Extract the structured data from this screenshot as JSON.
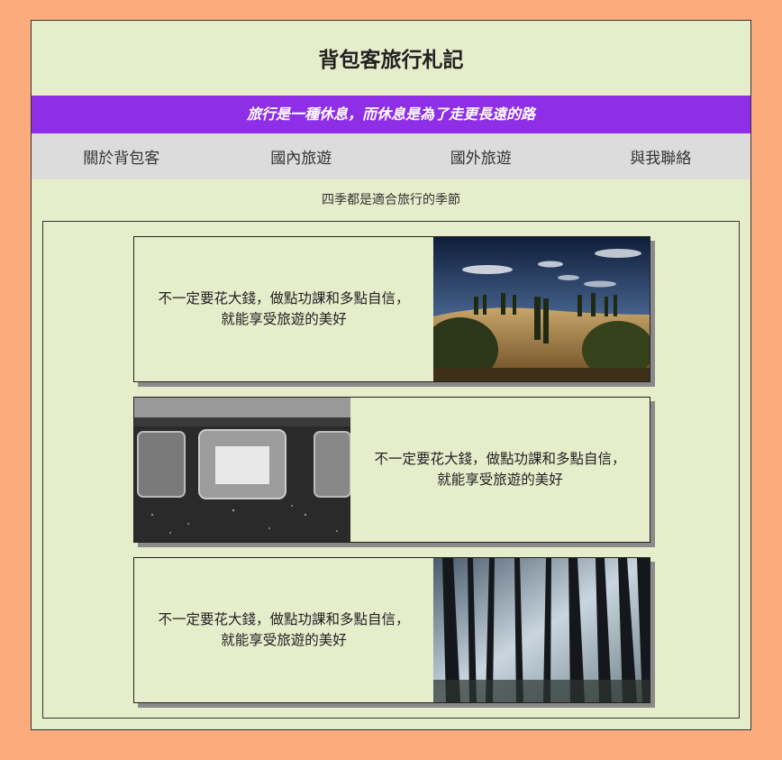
{
  "header": {
    "title": "背包客旅行札記",
    "slogan": "旅行是一種休息，而休息是為了走更長遠的路"
  },
  "nav": {
    "items": [
      "關於背包客",
      "國內旅遊",
      "國外旅遊",
      "與我聯絡"
    ]
  },
  "main": {
    "subtitle": "四季都是適合旅行的季節",
    "cards": [
      {
        "text_line1": "不一定要花大錢，做點功課和多點自信，",
        "text_line2": "就能享受旅遊的美好"
      },
      {
        "text_line1": "不一定要花大錢，做點功課和多點自信，",
        "text_line2": "就能享受旅遊的美好"
      },
      {
        "text_line1": "不一定要花大錢，做點功課和多點自信，",
        "text_line2": "就能享受旅遊的美好"
      }
    ]
  }
}
